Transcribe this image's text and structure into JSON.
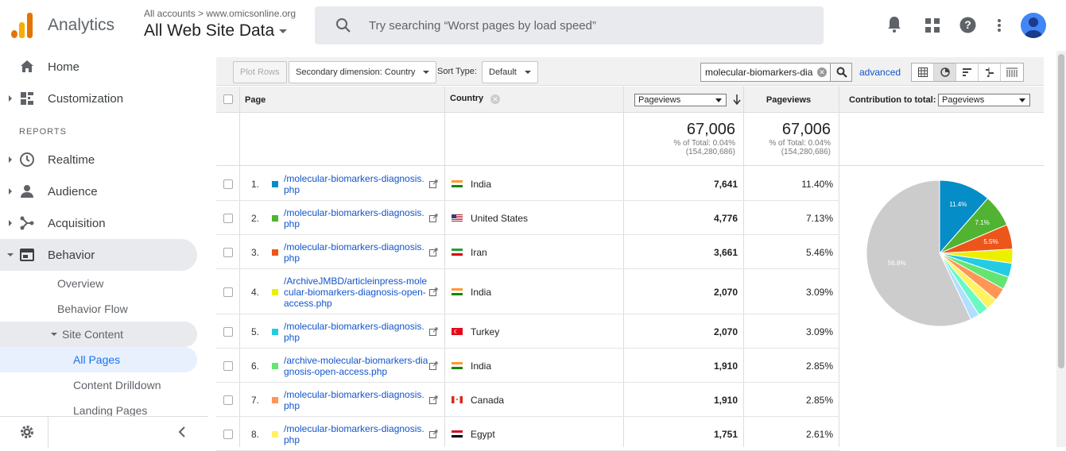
{
  "header": {
    "app_name": "Analytics",
    "account_path": "All accounts > www.omicsonline.org",
    "view_name": "All Web Site Data",
    "search_placeholder": "Try searching “Worst pages by load speed”",
    "logo_colors": [
      "#f9ab00",
      "#e37400",
      "#e37400"
    ]
  },
  "sidebar": {
    "home": "Home",
    "customization": "Customization",
    "reports_label": "REPORTS",
    "realtime": "Realtime",
    "audience": "Audience",
    "acquisition": "Acquisition",
    "behavior": "Behavior",
    "overview": "Overview",
    "behavior_flow": "Behavior Flow",
    "site_content": "Site Content",
    "all_pages": "All Pages",
    "content_drilldown": "Content Drilldown",
    "landing_pages": "Landing Pages"
  },
  "toolbar": {
    "plot_rows": "Plot Rows",
    "secondary_dimension": "Secondary dimension: Country",
    "sort_type_label": "Sort Type:",
    "sort_type_value": "Default",
    "filter_value": "molecular-biomarkers-dia",
    "advanced": "advanced"
  },
  "table": {
    "col_page": "Page",
    "col_country": "Country",
    "metric_select": "Pageviews",
    "col_pageviews": "Pageviews",
    "contribution_label": "Contribution to total:",
    "contribution_select": "Pageviews",
    "totals": {
      "value1": "67,006",
      "pct1": "% of Total: 0.04%",
      "base1": "(154,280,686)",
      "value2": "67,006",
      "pct2": "% of Total: 0.04%",
      "base2": "(154,280,686)"
    },
    "rows": [
      {
        "num": "1.",
        "page": "/molecular-biomarkers-diagnosis.php",
        "country": "India",
        "pageviews": "7,641",
        "percent": "11.40%",
        "color": "#058dc7"
      },
      {
        "num": "2.",
        "page": "/molecular-biomarkers-diagnosis.php",
        "country": "United States",
        "pageviews": "4,776",
        "percent": "7.13%",
        "color": "#50b432"
      },
      {
        "num": "3.",
        "page": "/molecular-biomarkers-diagnosis.php",
        "country": "Iran",
        "pageviews": "3,661",
        "percent": "5.46%",
        "color": "#ed561b"
      },
      {
        "num": "4.",
        "page": "/ArchiveJMBD/articleinpress-molecular-biomarkers-diagnosis-open-access.php",
        "country": "India",
        "pageviews": "2,070",
        "percent": "3.09%",
        "color": "#edef00"
      },
      {
        "num": "5.",
        "page": "/molecular-biomarkers-diagnosis.php",
        "country": "Turkey",
        "pageviews": "2,070",
        "percent": "3.09%",
        "color": "#24cbe5"
      },
      {
        "num": "6.",
        "page": "/archive-molecular-biomarkers-diagnosis-open-access.php",
        "country": "India",
        "pageviews": "1,910",
        "percent": "2.85%",
        "color": "#64e572"
      },
      {
        "num": "7.",
        "page": "/molecular-biomarkers-diagnosis.php",
        "country": "Canada",
        "pageviews": "1,910",
        "percent": "2.85%",
        "color": "#ff9655"
      },
      {
        "num": "8.",
        "page": "/molecular-biomarkers-diagnosis.php",
        "country": "Egypt",
        "pageviews": "1,751",
        "percent": "2.61%",
        "color": "#fff263"
      }
    ]
  },
  "chart_data": {
    "type": "pie",
    "slices": [
      {
        "value": 11.4,
        "label": "11.4%",
        "color": "#058dc7"
      },
      {
        "value": 7.13,
        "label": "7.1%",
        "color": "#50b432"
      },
      {
        "value": 5.46,
        "label": "5.5%",
        "color": "#ed561b"
      },
      {
        "value": 3.09,
        "label": "",
        "color": "#edef00"
      },
      {
        "value": 3.09,
        "label": "",
        "color": "#24cbe5"
      },
      {
        "value": 2.85,
        "label": "",
        "color": "#64e572"
      },
      {
        "value": 2.85,
        "label": "",
        "color": "#ff9655"
      },
      {
        "value": 2.61,
        "label": "",
        "color": "#fff263"
      },
      {
        "value": 2.3,
        "label": "",
        "color": "#6af9c4"
      },
      {
        "value": 2.0,
        "label": "",
        "color": "#b2deff"
      },
      {
        "value": 56.8,
        "label": "56.8%",
        "color": "#cccccc"
      }
    ]
  }
}
